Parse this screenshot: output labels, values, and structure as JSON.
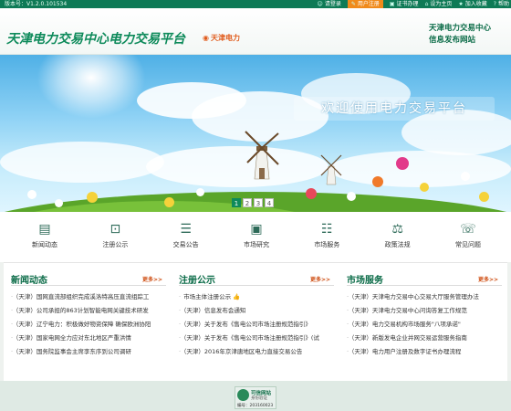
{
  "topbar": {
    "version": "版本号：V1.2.0.101534",
    "links": [
      {
        "label": "请登录",
        "icon": "user-icon"
      },
      {
        "label": "用户注册",
        "icon": "register-icon"
      },
      {
        "label": "证书办理",
        "icon": "certificate-icon"
      },
      {
        "label": "设为主页",
        "icon": "home-icon"
      },
      {
        "label": "加入收藏",
        "icon": "star-icon"
      },
      {
        "label": "帮助",
        "icon": "help-icon"
      }
    ]
  },
  "header": {
    "logo": "天津电力交易中心电力交易平台",
    "location": "天津电力",
    "right_line1": "天津电力交易中心",
    "right_line2": "信息发布网站"
  },
  "banner": {
    "slogan": "欢迎使用电力交易平台",
    "pages": [
      "1",
      "2",
      "3",
      "4"
    ],
    "active_page": "1"
  },
  "quick_links": [
    {
      "label": "新闻动态",
      "icon": "news-icon"
    },
    {
      "label": "注册公示",
      "icon": "register-notice-icon"
    },
    {
      "label": "交易公告",
      "icon": "trade-notice-icon"
    },
    {
      "label": "市场研究",
      "icon": "research-icon"
    },
    {
      "label": "市场服务",
      "icon": "service-icon"
    },
    {
      "label": "政策法规",
      "icon": "policy-icon"
    },
    {
      "label": "常见问题",
      "icon": "faq-icon"
    }
  ],
  "news": {
    "title": "新闻动态",
    "more": "更多>>",
    "items": [
      "（天津）国网直流部组织完成溪洛特高压直流组踪工",
      "（天津）公司承担的863计划智能电网关键技术研发",
      "（天津）辽宁电力：积极做好物资保障 确保欧洲协阳",
      "（天津）国家电网全力应对东北地区严重洪情",
      "（天津）国务院监事会主席李东序到公司调研"
    ]
  },
  "register": {
    "title": "注册公示",
    "more": "更多>>",
    "items": [
      "市场主体注册公示",
      "（天津）信息发布会通知",
      "（天津）关于发布《售电公司市场注册规范指引》",
      "（天津）关于发布《售电公司市场注册规范指引》(试",
      "（天津）2016年京津唐地区电力直接交易公告"
    ]
  },
  "service": {
    "title": "市场服务",
    "more": "更多>>",
    "items": [
      "（天津）天津电力交易中心交易大厅服务管理办法",
      "（天津）天津电力交易中心问询答复工作规范",
      "（天津）电力交易机构市场服务\"八项承诺\"",
      "（天津）新版发电企业并网交易运营服务指南",
      "（天津）电力用户注册及数字证书办理流程"
    ]
  },
  "footer": {
    "seal_line1": "可信网站",
    "seal_line2": "身份验证",
    "seal_id": "编号：203160023"
  }
}
